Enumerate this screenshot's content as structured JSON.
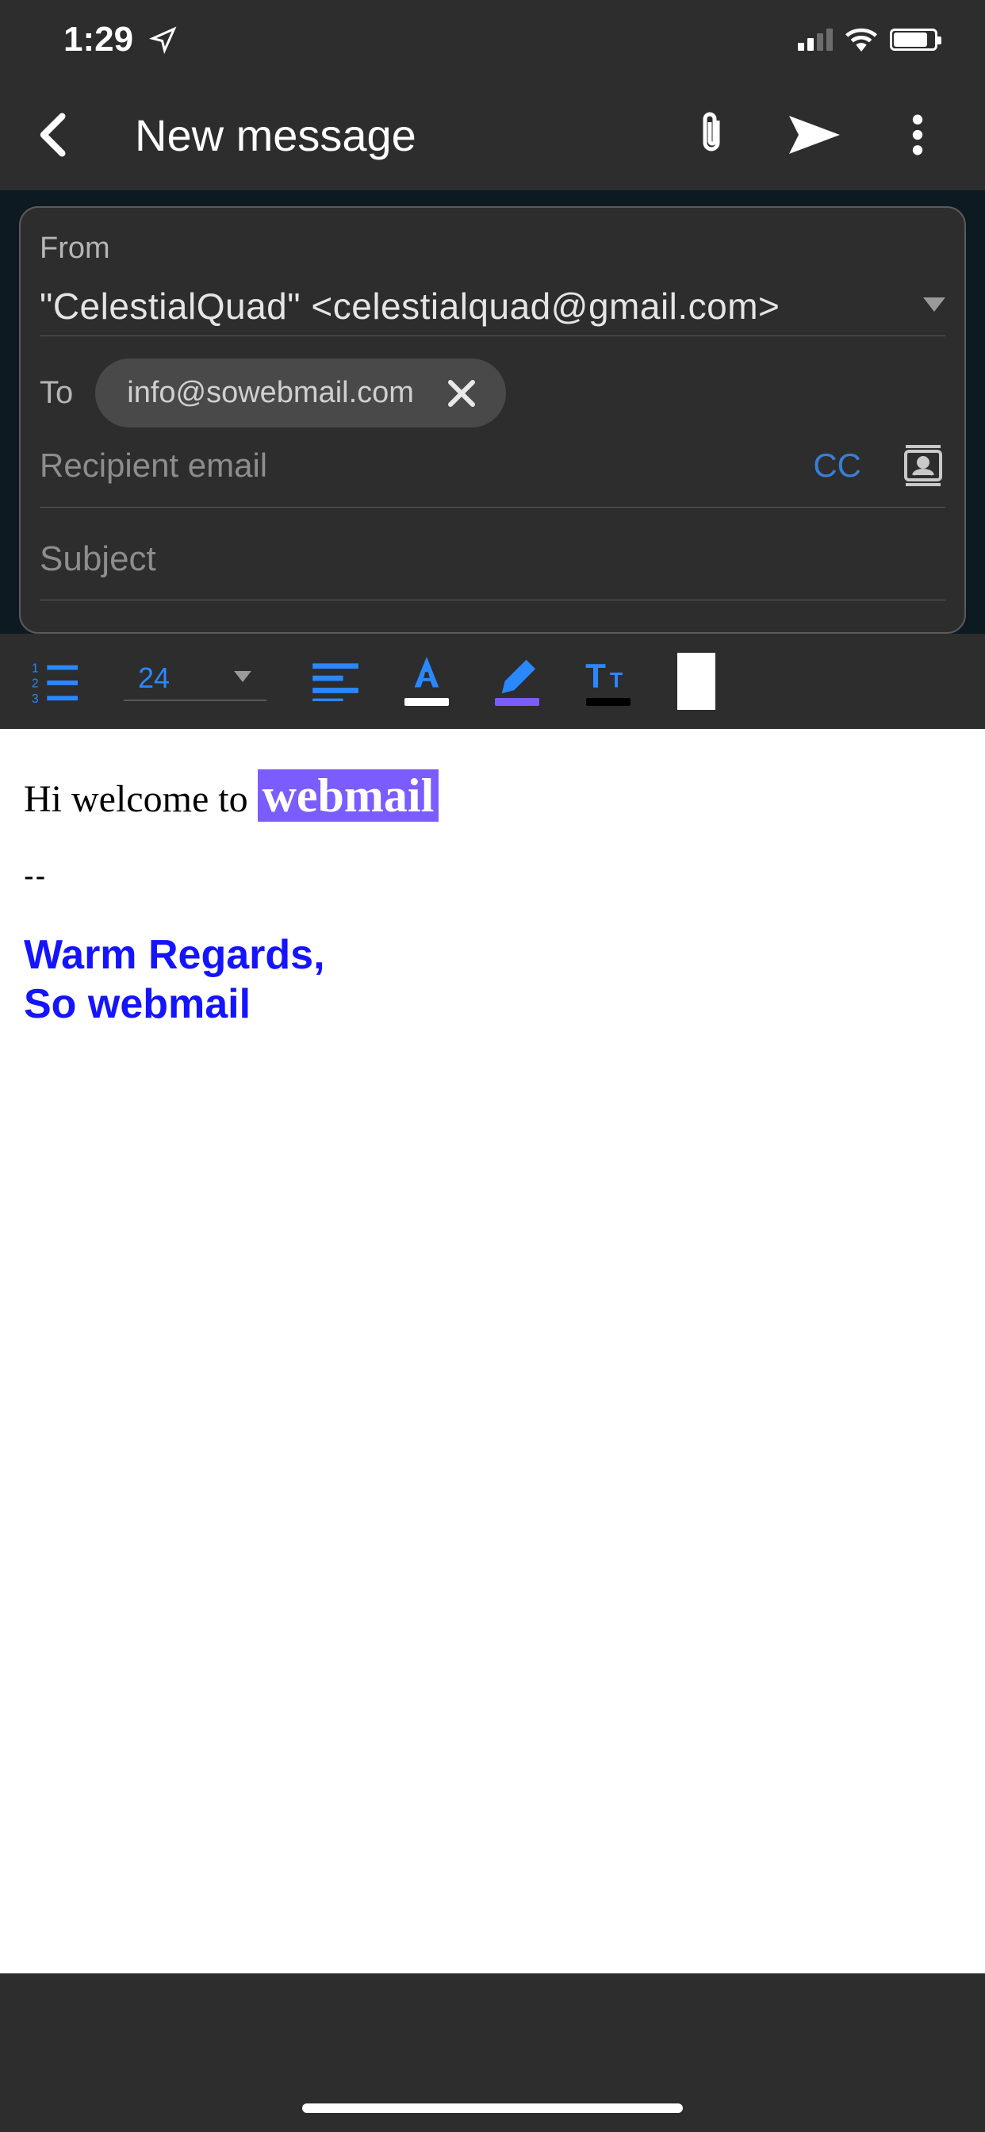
{
  "status": {
    "time": "1:29"
  },
  "header": {
    "title": "New message"
  },
  "compose": {
    "from_label": "From",
    "from_value": "\"CelestialQuad\" <celestialquad@gmail.com>",
    "to_label": "To",
    "to_chip": "info@sowebmail.com",
    "recipient_placeholder": "Recipient email",
    "cc_label": "CC",
    "subject_placeholder": "Subject"
  },
  "format_toolbar": {
    "font_size": "24",
    "text_color_underline": "#ffffff",
    "highlight_color_underline": "#7b5cff",
    "tt_underline": "#000000",
    "swatch_color": "#ffffff"
  },
  "body": {
    "greeting_prefix": "Hi welcome to ",
    "greeting_highlight": "webmail",
    "separator": "--",
    "signature_line1": "Warm Regards,",
    "signature_line2": "So webmail"
  }
}
